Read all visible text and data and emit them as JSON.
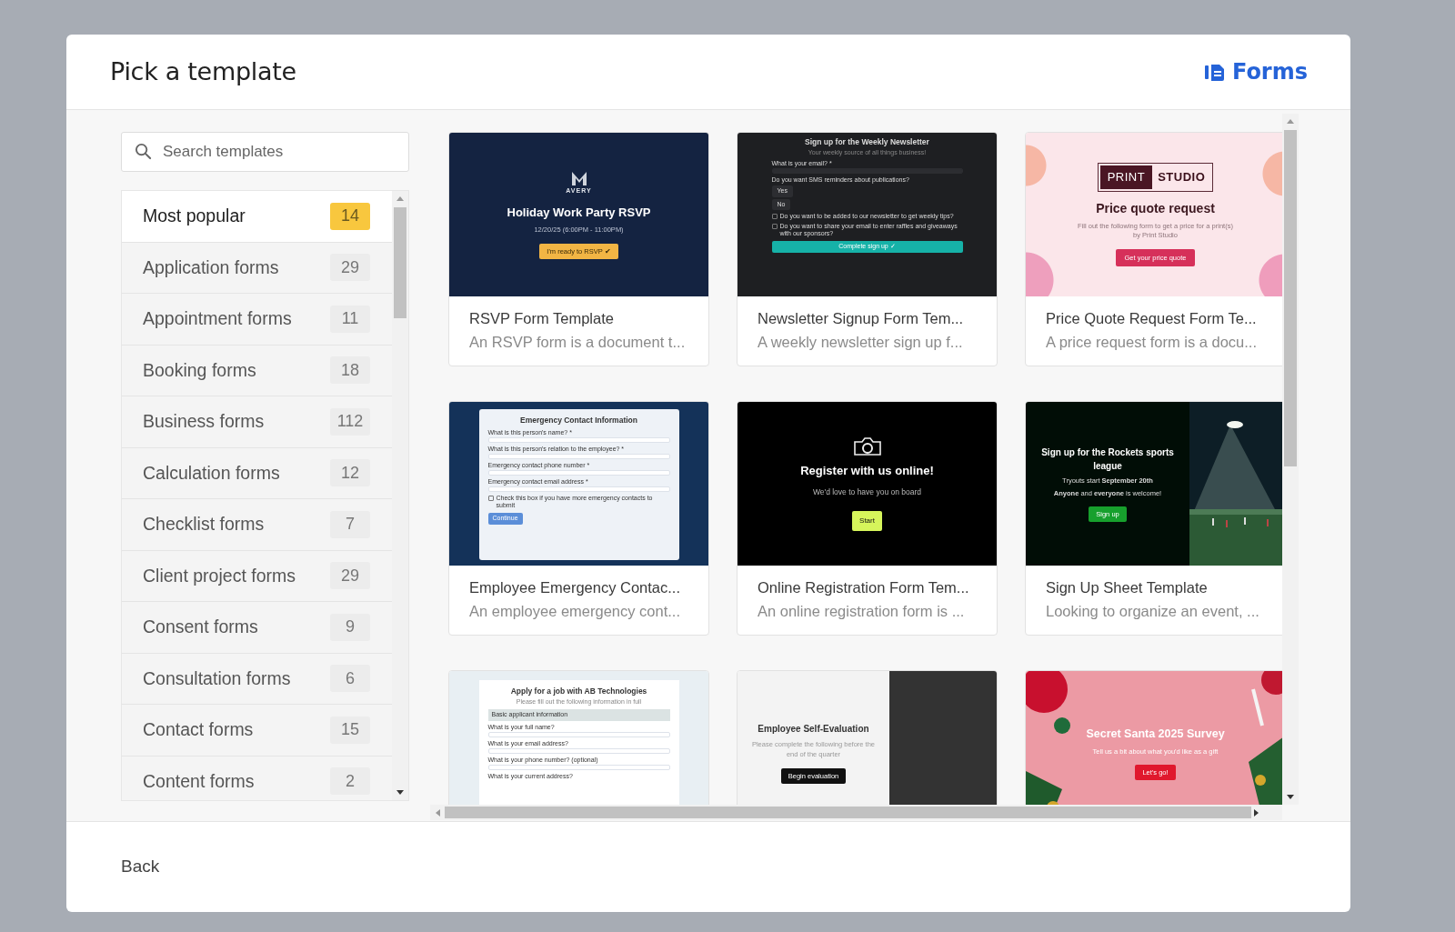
{
  "header": {
    "title": "Pick a template",
    "brand": "Forms"
  },
  "search": {
    "placeholder": "Search templates"
  },
  "categories": [
    {
      "label": "Most popular",
      "count": "14",
      "selected": true
    },
    {
      "label": "Application forms",
      "count": "29",
      "selected": false
    },
    {
      "label": "Appointment forms",
      "count": "11",
      "selected": false
    },
    {
      "label": "Booking forms",
      "count": "18",
      "selected": false
    },
    {
      "label": "Business forms",
      "count": "112",
      "selected": false
    },
    {
      "label": "Calculation forms",
      "count": "12",
      "selected": false
    },
    {
      "label": "Checklist forms",
      "count": "7",
      "selected": false
    },
    {
      "label": "Client project forms",
      "count": "29",
      "selected": false
    },
    {
      "label": "Consent forms",
      "count": "9",
      "selected": false
    },
    {
      "label": "Consultation forms",
      "count": "6",
      "selected": false
    },
    {
      "label": "Contact forms",
      "count": "15",
      "selected": false
    },
    {
      "label": "Content forms",
      "count": "2",
      "selected": false
    }
  ],
  "templates": [
    {
      "name": "RSVP Form Template",
      "description": "An RSVP form is a document t...",
      "thumbnail": {
        "kind": "navy",
        "logo": [
          "AVERY"
        ],
        "title": "Holiday Work Party RSVP",
        "subtitle": [
          "12/20/25 (6:00PM - 11:00PM)"
        ],
        "button": "I'm ready to RSVP ✔"
      }
    },
    {
      "name": "Newsletter Signup Form Tem...",
      "description": "A weekly newsletter sign up f...",
      "thumbnail": {
        "kind": "charcoal",
        "title": "Sign up for the Weekly Newsletter",
        "subtitle": [
          "Your weekly source of all things business!"
        ],
        "fields": [
          {
            "kind": "input",
            "label": "What is your email? *"
          },
          {
            "kind": "text",
            "label": "Do you want SMS reminders about publications?"
          },
          {
            "kind": "option",
            "label": "Yes"
          },
          {
            "kind": "option",
            "label": "No"
          },
          {
            "kind": "check",
            "label": "Do you want to be added to our newsletter to get weekly tips?",
            "checked": false
          },
          {
            "kind": "check",
            "label": "Do you want to share your email to enter raffles and giveaways with our sponsors?",
            "checked": false
          }
        ],
        "button": "Complete sign up ✓"
      }
    },
    {
      "name": "Price Quote Request Form Te...",
      "description": "A price request form is a docu...",
      "thumbnail": {
        "kind": "blush",
        "logo": [
          "PRINT",
          "STUDIO"
        ],
        "title": "Price quote request",
        "subtitle": [
          "Fill out the following form to get a price for a print(s) by Print Studio"
        ],
        "button": "Get your price quote"
      }
    },
    {
      "name": "Employee Emergency Contac...",
      "description": "An employee emergency cont...",
      "thumbnail": {
        "kind": "navyform",
        "title": "Emergency Contact Information",
        "fields": [
          {
            "kind": "input",
            "label": "What is this person's name? *"
          },
          {
            "kind": "input",
            "label": "What is this person's relation to the employee? *"
          },
          {
            "kind": "input",
            "label": "Emergency contact phone number *"
          },
          {
            "kind": "input",
            "label": "Emergency contact email address *"
          },
          {
            "kind": "check",
            "label": "Check this box if you have more emergency contacts to submit",
            "checked": false
          }
        ],
        "button": "Continue"
      }
    },
    {
      "name": "Online Registration Form Tem...",
      "description": "An online registration form is ...",
      "thumbnail": {
        "kind": "black",
        "title": "Register with us online!",
        "subtitle": [
          "We'd love to have you on board"
        ],
        "button": "Start"
      }
    },
    {
      "name": "Sign Up Sheet Template",
      "description": "Looking to organize an event, ...",
      "thumbnail": {
        "kind": "stadium",
        "title": "Sign up for the Rockets sports league",
        "subtitle": [
          "Tryouts start **September 20th**",
          "**Anyone** and **everyone** is welcome!"
        ],
        "button": "Sign up"
      }
    },
    {
      "thumbnail": {
        "kind": "paleform",
        "title": "Apply for a job with AB Technologies",
        "subtitle": [
          "Please fill out the following information in full"
        ],
        "fields": [
          {
            "kind": "section",
            "label": "Basic applicant information"
          },
          {
            "kind": "input",
            "label": "What is your full name?"
          },
          {
            "kind": "input",
            "label": "What is your email address?"
          },
          {
            "kind": "input",
            "label": "What is your phone number? (optional)"
          },
          {
            "kind": "text",
            "label": "What is your current address?"
          }
        ]
      }
    },
    {
      "thumbnail": {
        "kind": "split",
        "title": "Employee Self-Evaluation",
        "subtitle": [
          "Please complete the following before the end of the quarter"
        ],
        "button": "Begin evaluation"
      }
    },
    {
      "thumbnail": {
        "kind": "festive",
        "title": "Secret Santa 2025 Survey",
        "subtitle": [
          "Tell us a bit about what you'd like as a gift"
        ],
        "button": "Let's go!"
      }
    }
  ],
  "footer": {
    "back": "Back"
  }
}
